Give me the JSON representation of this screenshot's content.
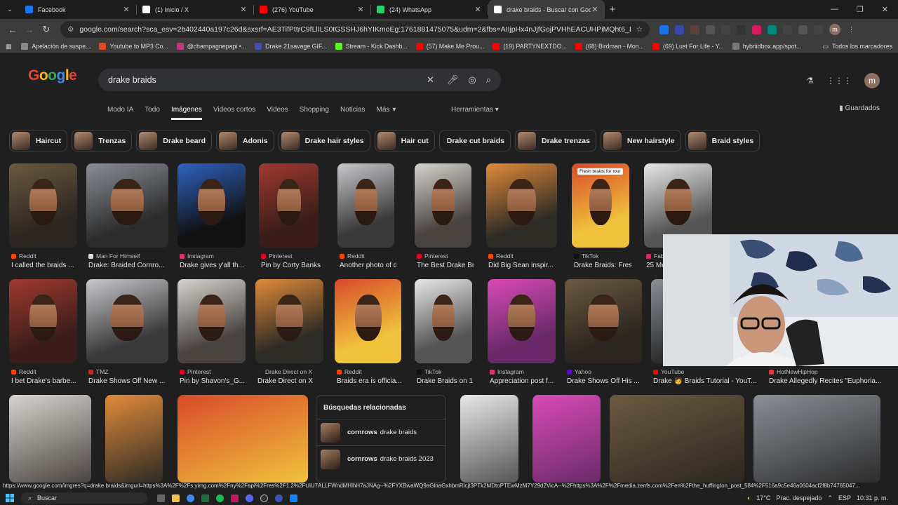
{
  "browser": {
    "tabs": [
      {
        "title": "Facebook",
        "color": "#1877f2",
        "active": false
      },
      {
        "title": "(1) Inicio / X",
        "color": "#ffffff",
        "active": false
      },
      {
        "title": "(276) YouTube",
        "color": "#ff0000",
        "active": false
      },
      {
        "title": "(24) WhatsApp",
        "color": "#25d366",
        "active": false
      },
      {
        "title": "drake braids - Buscar con Goog",
        "color": "#ffffff",
        "active": true
      }
    ],
    "url": "google.com/search?sca_esv=2b402440a197c26d&sxsrf=AE3TifPttrC9fLlILS0tGSSHJ6hYIKmoEg:1761881475075&udm=2&fbs=AIIjpHx4nJjfGojPVHhEACUHPiMQht6_BFq6vBIoFFRK7qchKEOG9SkJ7O...",
    "bookmarks": [
      {
        "label": "Apelación de suspe...",
        "color": "#888888"
      },
      {
        "label": "Youtube to MP3 Co...",
        "color": "#e64a19"
      },
      {
        "label": "@champagnepapi •...",
        "color": "#c13584"
      },
      {
        "label": "Drake 21savage GIF...",
        "color": "#3f51b5"
      },
      {
        "label": "Stream - Kick Dashb...",
        "color": "#53fc18"
      },
      {
        "label": "(57) Make Me Prou...",
        "color": "#ff0000"
      },
      {
        "label": "(19) PARTYNEXTDO...",
        "color": "#ff0000"
      },
      {
        "label": "(68) Birdman - Mon...",
        "color": "#ff0000"
      },
      {
        "label": "(69) Lust For Life - Y...",
        "color": "#ff0000"
      },
      {
        "label": "hybriidbox.app/spot...",
        "color": "#777777"
      }
    ],
    "bookmarks_right": "Todos los marcadores",
    "profile_initial": "m"
  },
  "google": {
    "query": "drake braids",
    "tabs": [
      "Modo IA",
      "Todo",
      "Imágenes",
      "Videos cortos",
      "Videos",
      "Shopping",
      "Noticias",
      "Más"
    ],
    "tools": "Herramientas",
    "saved": "Guardados",
    "profile_initial": "m",
    "chips": [
      {
        "label": "Haircut",
        "img": true
      },
      {
        "label": "Trenzas",
        "img": true
      },
      {
        "label": "Drake beard",
        "img": true
      },
      {
        "label": "Adonis",
        "img": true
      },
      {
        "label": "Drake hair styles",
        "img": true
      },
      {
        "label": "Hair cut",
        "img": true
      },
      {
        "label": "Drake cut braids",
        "img": false
      },
      {
        "label": "Drake trenzas",
        "img": true
      },
      {
        "label": "New hairstyle",
        "img": true
      },
      {
        "label": "Braid styles",
        "img": true
      }
    ],
    "results_row1": [
      {
        "source": "Reddit",
        "title": "I called the braids ...",
        "src_color": "#ff4500"
      },
      {
        "source": "Man For Himself",
        "title": "Drake: Braided Cornro...",
        "src_color": "#dddddd"
      },
      {
        "source": "Instagram",
        "title": "Drake gives y'all th...",
        "src_color": "#e1306c"
      },
      {
        "source": "Pinterest",
        "title": "Pin by Corty Banks...",
        "src_color": "#e60023"
      },
      {
        "source": "Reddit",
        "title": "Another photo of d...",
        "src_color": "#ff4500"
      },
      {
        "source": "Pinterest",
        "title": "The Best Drake Br...",
        "src_color": "#e60023"
      },
      {
        "source": "Reddit",
        "title": "Did Big Sean inspir...",
        "src_color": "#ff4500"
      },
      {
        "source": "TikTok",
        "title": "Drake Braids: Fres...",
        "src_color": "#111111"
      },
      {
        "source": "Fab",
        "title": "25 Mo",
        "src_color": "#e91e63"
      }
    ],
    "results_row2": [
      {
        "source": "Reddit",
        "title": "I bet Drake's barbe...",
        "src_color": "#ff4500"
      },
      {
        "source": "TMZ",
        "title": "Drake Shows Off New ...",
        "src_color": "#c62828"
      },
      {
        "source": "Pinterest",
        "title": "Pin by Shavon's_G...",
        "src_color": "#e60023"
      },
      {
        "source": "Drake Direct on X",
        "title": "Drake Direct on X",
        "src_color": "#222222"
      },
      {
        "source": "Reddit",
        "title": "Braids era is officia...",
        "src_color": "#ff4500"
      },
      {
        "source": "TikTok",
        "title": "Drake Braids on 1 ...",
        "src_color": "#111111"
      },
      {
        "source": "Instagram",
        "title": "Appreciation post f...",
        "src_color": "#e1306c"
      },
      {
        "source": "Yahoo",
        "title": "Drake Shows Off His ...",
        "src_color": "#6001d2"
      },
      {
        "source": "YouTube",
        "title": "Drake 🧑 Braids Tutorial - YouT...",
        "src_color": "#ff0000"
      },
      {
        "source": "HotNewHipHop",
        "title": "Drake Allegedly Recites \"Euphoria...",
        "src_color": "#e53935"
      }
    ],
    "tiktok_caption": "Fresh braids for tour",
    "related": {
      "heading": "Búsquedas relacionadas",
      "items": [
        {
          "bold": "cornrows",
          "rest": "drake braids"
        },
        {
          "bold": "cornrows",
          "rest": "drake braids 2023"
        }
      ]
    }
  },
  "status_url": "https://www.google.com/imgres?q=drake braids&imgurl=https%3A%2F%2Fs.yimg.com%2Fny%2Fapi%2Fres%2F1.2%2FUiU7ALLFWndMHlhH7aJNAg--%2FYXBwaWQ9aGlnaGxhbmRlcjt3PTk2MDtoPTEwMzM7Y29d2VicA--%2Fhttps%3A%2F%2Fmedia.zenfs.com%2Fen%2Fthe_huffington_post_584%2F516a9c5e46a0604acf2f8b74765047...",
  "taskbar": {
    "search_placeholder": "Buscar",
    "temperature": "17°C",
    "weather": "Prac. despejado",
    "lang": "ESP",
    "time": "10:31 p. m."
  },
  "colors": {
    "background": "#1f1f1f",
    "accent": "#8ab4f8"
  }
}
